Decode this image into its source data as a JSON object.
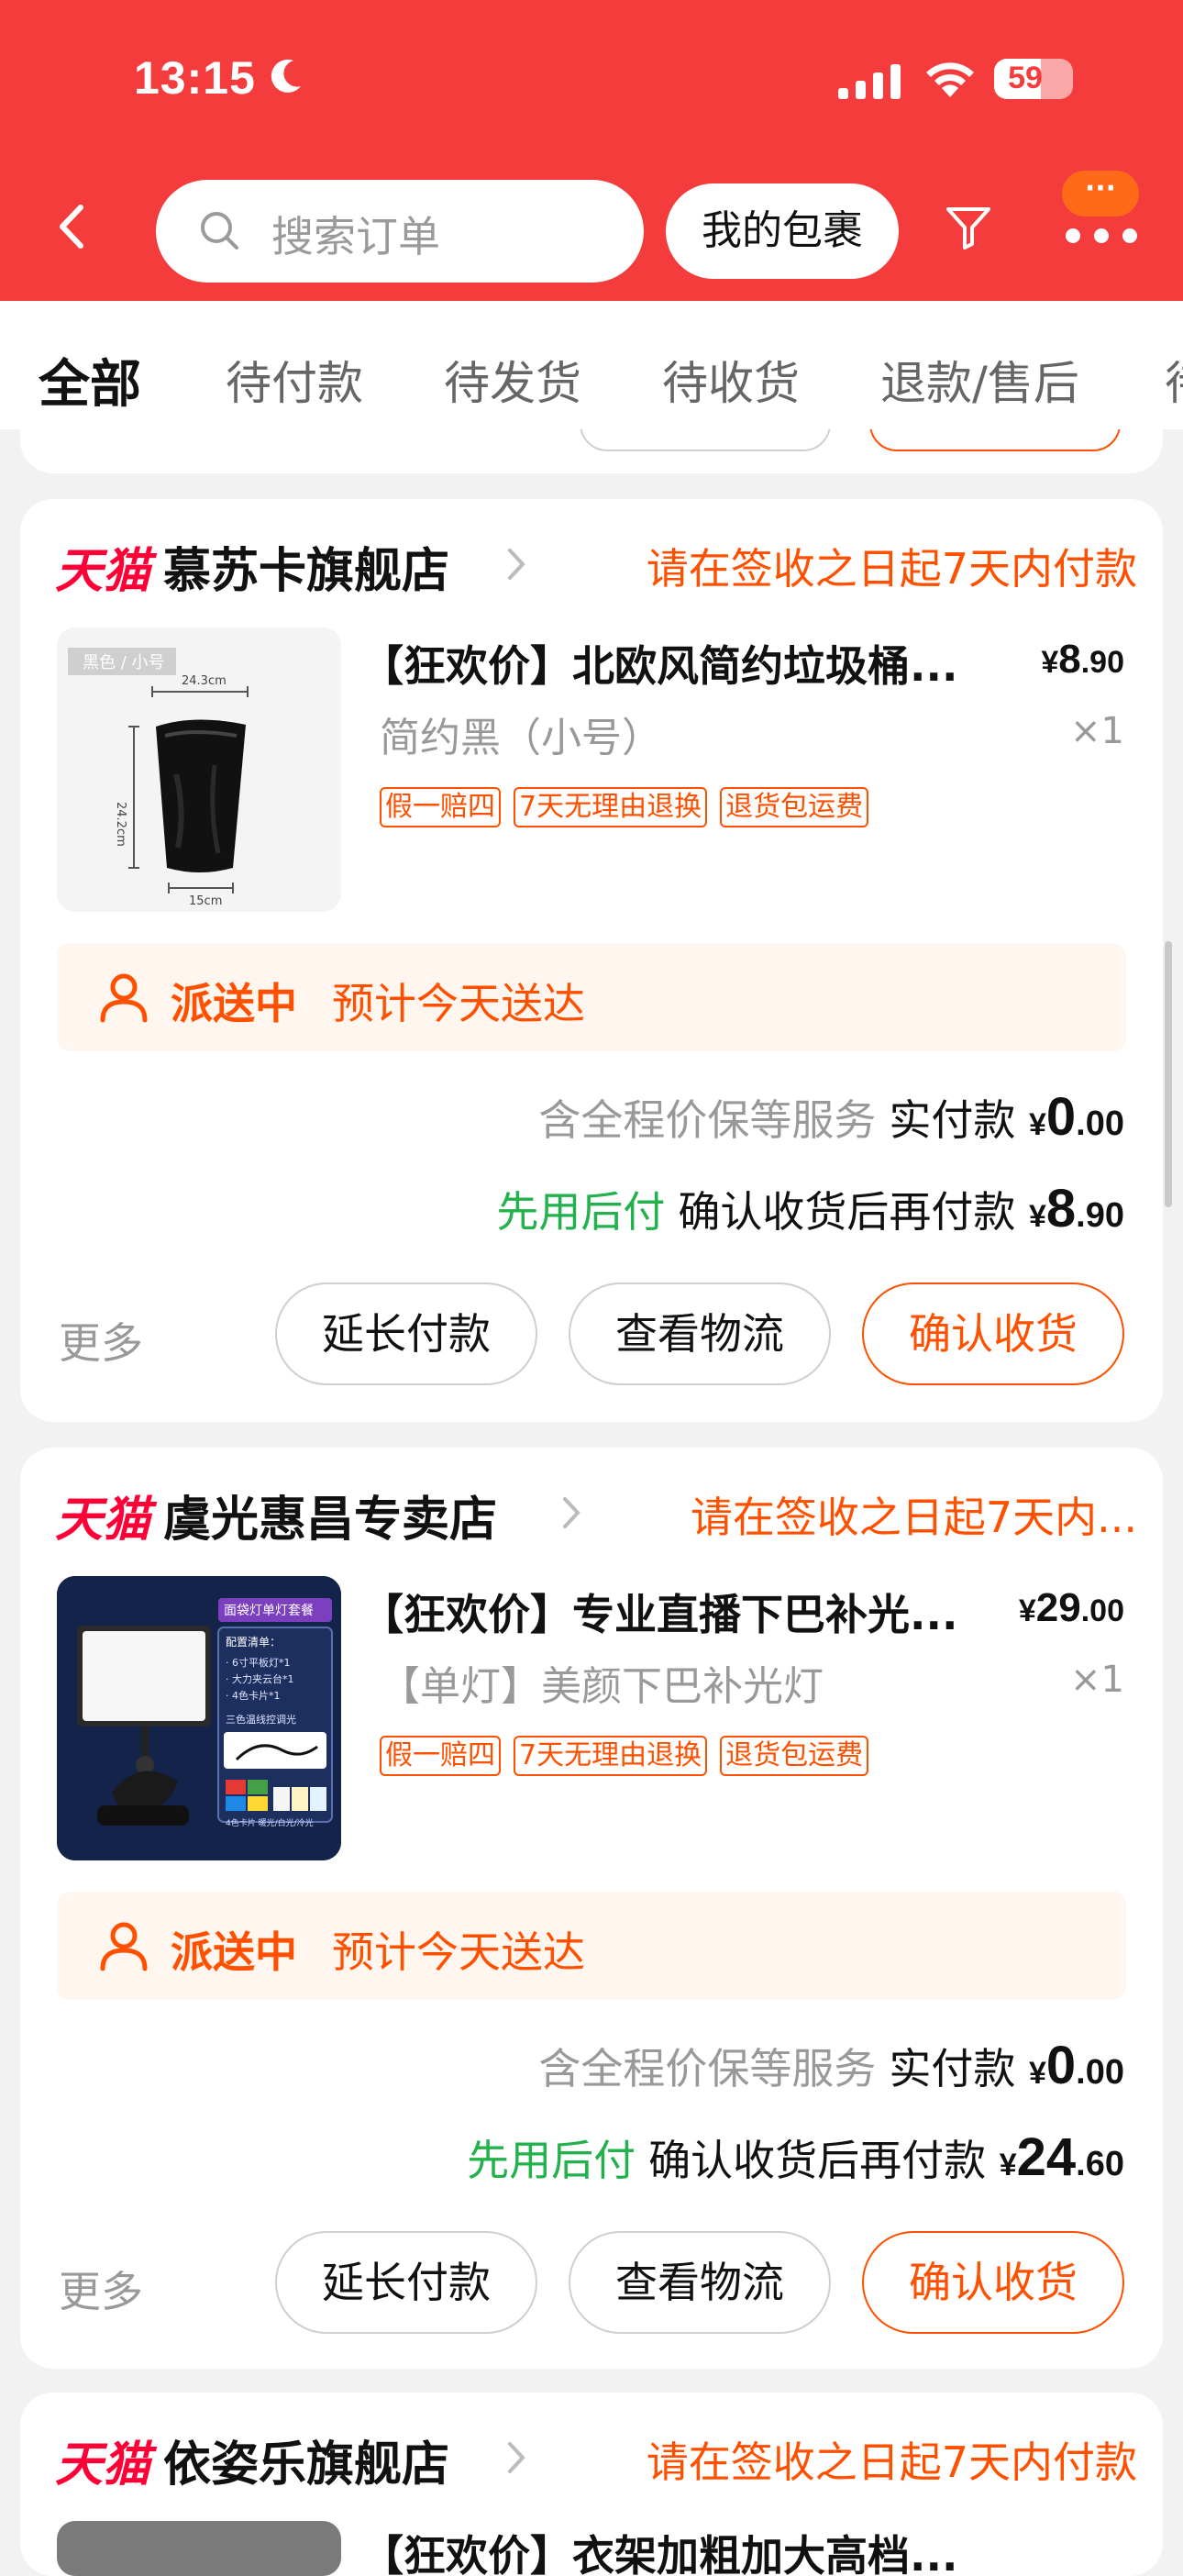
{
  "status_bar": {
    "time": "13:15",
    "battery": "59",
    "battery_level": 0.59
  },
  "header": {
    "search_placeholder": "搜索订单",
    "packages_button": "我的包裹",
    "more_badge": "···"
  },
  "tabs": [
    "全部",
    "待付款",
    "待发货",
    "待收货",
    "退款/售后",
    "待"
  ],
  "orders": [
    {
      "platform": "天猫",
      "shop": "慕苏卡旗舰店",
      "pay_note": "请在签收之日起7天内付款",
      "thumb_label": "黑色 / 小号",
      "thumb_dims": [
        "24.3cm",
        "24.2cm",
        "15cm"
      ],
      "title": "【狂欢价】北欧风简约垃圾桶...",
      "price_cur": "¥",
      "price_int": "8",
      "price_dec": ".90",
      "variant": "简约黑（小号）",
      "qty": "×1",
      "tags": [
        "假一赔四",
        "7天无理由退换",
        "退货包运费"
      ],
      "delivery_status": "派送中",
      "delivery_eta": "预计今天送达",
      "service_note": "含全程价保等服务",
      "paid_label": "实付款",
      "paid_cur": "¥",
      "paid_int": "0",
      "paid_dec": ".00",
      "later_label": "先用后付",
      "later_text": "确认收货后再付款",
      "later_cur": "¥",
      "later_int": "8",
      "later_dec": ".90",
      "more": "更多",
      "btn_extend": "延长付款",
      "btn_logistics": "查看物流",
      "btn_confirm": "确认收货"
    },
    {
      "platform": "天猫",
      "shop": "虞光惠昌专卖店",
      "pay_note": "请在签收之日起7天内...",
      "thumb_header": "面袋灯单灯套餐",
      "thumb_list": [
        "配置清单：",
        "· 6寸平板灯*1",
        "· 大力夹云台*1",
        "· 4色卡片*1",
        "三色温线控调光"
      ],
      "thumb_caption": "4色卡片   暖光/白光/冷光",
      "title": "【狂欢价】专业直播下巴补光...",
      "price_cur": "¥",
      "price_int": "29",
      "price_dec": ".00",
      "variant": "【单灯】美颜下巴补光灯",
      "qty": "×1",
      "tags": [
        "假一赔四",
        "7天无理由退换",
        "退货包运费"
      ],
      "delivery_status": "派送中",
      "delivery_eta": "预计今天送达",
      "service_note": "含全程价保等服务",
      "paid_label": "实付款",
      "paid_cur": "¥",
      "paid_int": "0",
      "paid_dec": ".00",
      "later_label": "先用后付",
      "later_text": "确认收货后再付款",
      "later_cur": "¥",
      "later_int": "24",
      "later_dec": ".60",
      "more": "更多",
      "btn_extend": "延长付款",
      "btn_logistics": "查看物流",
      "btn_confirm": "确认收货"
    },
    {
      "platform": "天猫",
      "shop": "依姿乐旗舰店",
      "pay_note": "请在签收之日起7天内付款",
      "title": "【狂欢价】衣架加粗加大高档..."
    }
  ]
}
